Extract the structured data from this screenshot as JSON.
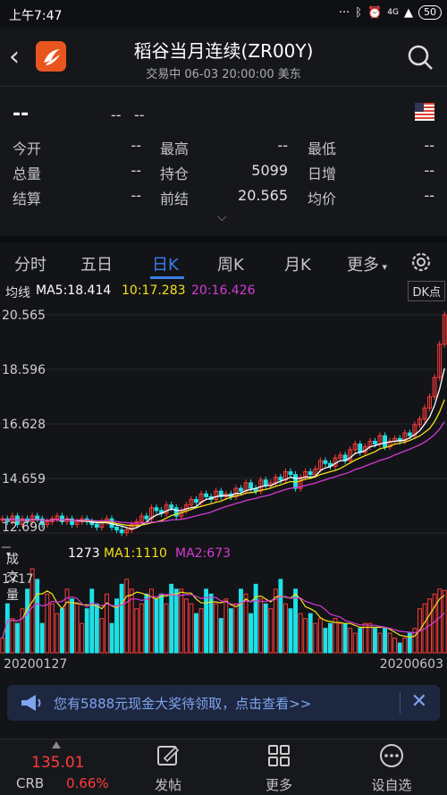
{
  "status": {
    "time": "上午7:47",
    "signal": "4G",
    "battery": "50"
  },
  "header": {
    "title": "稻谷当月连续(ZR00Y)",
    "subtitle": "交易中  06-03 20:00:00  美东"
  },
  "quote": {
    "last": "--",
    "change": "--",
    "change_pct": "--",
    "rows": [
      [
        {
          "label": "今开",
          "value": "--"
        },
        {
          "label": "最高",
          "value": "--"
        },
        {
          "label": "最低",
          "value": "--"
        }
      ],
      [
        {
          "label": "总量",
          "value": "--"
        },
        {
          "label": "持仓",
          "value": "5099"
        },
        {
          "label": "日增",
          "value": "--"
        }
      ],
      [
        {
          "label": "结算",
          "value": "--"
        },
        {
          "label": "前结",
          "value": "20.565"
        },
        {
          "label": "均价",
          "value": "--"
        }
      ]
    ]
  },
  "tabs": [
    "分时",
    "五日",
    "日K",
    "周K",
    "月K",
    "更多"
  ],
  "active_tab": "日K",
  "ma": {
    "title": "均线",
    "ma5": "MA5:18.414",
    "ma10": "10:17.283",
    "ma20": "20:16.426",
    "dk": "DK点",
    "colors": {
      "ma5": "#ffffff",
      "ma10": "#f2e01a",
      "ma20": "#d43ad7"
    }
  },
  "volume": {
    "label": "成交量",
    "value": "1273",
    "ma1": "MA1:1110",
    "ma2": "MA2:673",
    "ymax": "1717"
  },
  "dates": {
    "start": "20200127",
    "end": "20200603"
  },
  "ad": {
    "text": "您有5888元现金大奖待领取，点击查看>>"
  },
  "bottom": {
    "price": "135.01",
    "code": "CRB",
    "pct": "0.66%",
    "items": [
      "发帖",
      "更多",
      "设自选"
    ]
  },
  "colors": {
    "up": "#ff3b3b",
    "down": "#1fe0e6",
    "accent": "#3d7eea"
  },
  "chart_data": {
    "type": "candlestick",
    "y_ticks": [
      "20.565",
      "18.596",
      "16.628",
      "14.659",
      "12.690"
    ],
    "ylim": [
      12.69,
      20.565
    ],
    "x_start": "20200127",
    "x_end": "20200603",
    "closes": [
      13.2,
      13.1,
      13.3,
      13.0,
      13.2,
      13.1,
      13.3,
      13.2,
      13.0,
      13.1,
      13.2,
      13.3,
      13.1,
      13.2,
      13.0,
      13.1,
      13.2,
      13.1,
      13.0,
      12.9,
      13.1,
      13.2,
      12.9,
      12.8,
      12.7,
      12.8,
      13.0,
      13.1,
      13.3,
      13.2,
      13.6,
      13.5,
      13.4,
      13.7,
      13.6,
      13.3,
      13.5,
      13.7,
      13.9,
      13.8,
      14.1,
      14.0,
      13.9,
      14.2,
      14.0,
      14.1,
      14.0,
      14.3,
      14.2,
      14.5,
      14.3,
      14.2,
      14.6,
      14.4,
      14.5,
      14.7,
      14.6,
      14.9,
      14.8,
      14.3,
      14.7,
      14.9,
      14.8,
      15.0,
      15.3,
      15.2,
      15.1,
      15.4,
      15.5,
      15.3,
      15.7,
      15.9,
      15.6,
      15.8,
      16.0,
      15.9,
      16.2,
      15.8,
      16.0,
      16.1,
      16.0,
      16.3,
      16.2,
      16.6,
      16.8,
      17.2,
      17.6,
      18.3,
      19.5,
      20.565
    ],
    "volumes": [
      300,
      1000,
      700,
      600,
      900,
      1300,
      1717,
      1500,
      600,
      1200,
      1000,
      800,
      900,
      1300,
      1100,
      1000,
      600,
      900,
      1300,
      1000,
      700,
      1200,
      600,
      1100,
      1400,
      1500,
      1300,
      900,
      1000,
      1200,
      1300,
      1100,
      1200,
      1000,
      1400,
      1300,
      1300,
      1100,
      1000,
      800,
      900,
      1300,
      1200,
      1000,
      700,
      1100,
      900,
      1000,
      1300,
      1200,
      800,
      1400,
      1100,
      1000,
      900,
      1300,
      1500,
      1000,
      900,
      1300,
      800,
      700,
      800,
      600,
      700,
      500,
      600,
      700,
      600,
      600,
      500,
      400,
      500,
      600,
      600,
      500,
      400,
      500,
      400,
      300,
      200,
      300,
      400,
      500,
      900,
      1000,
      1100,
      1200,
      1300,
      1273
    ]
  }
}
